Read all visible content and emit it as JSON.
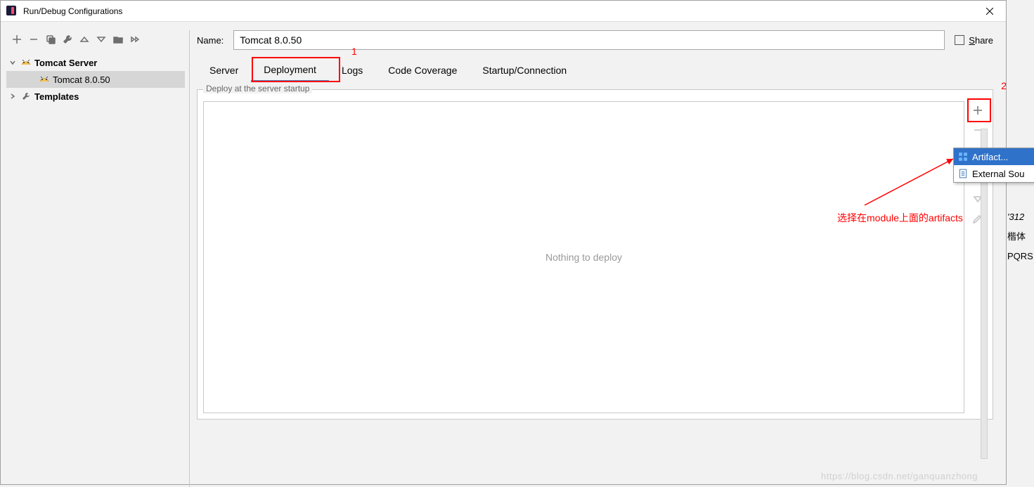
{
  "titlebar": {
    "title": "Run/Debug Configurations"
  },
  "tree": {
    "root": {
      "label": "Tomcat Server"
    },
    "child": {
      "label": "Tomcat 8.0.50"
    },
    "templates": {
      "label": "Templates"
    }
  },
  "name": {
    "label": "Name:",
    "value": "Tomcat 8.0.50"
  },
  "share": {
    "label": "Share"
  },
  "tabs": {
    "t0": "Server",
    "t1": "Deployment",
    "t2": "Logs",
    "t3": "Code Coverage",
    "t4": "Startup/Connection"
  },
  "fieldset": {
    "legend": "Deploy at the server startup",
    "empty": "Nothing to deploy"
  },
  "popup": {
    "item0": "Artifact...",
    "item1": "External Sou"
  },
  "annotations": {
    "a1": "1",
    "a2": "2",
    "hint": "选择在module上面的artifacts"
  },
  "bg": {
    "l1": "'312",
    "l2": "楷体",
    "l3": "PQRS"
  },
  "watermark": "https://blog.csdn.net/ganquanzhong"
}
